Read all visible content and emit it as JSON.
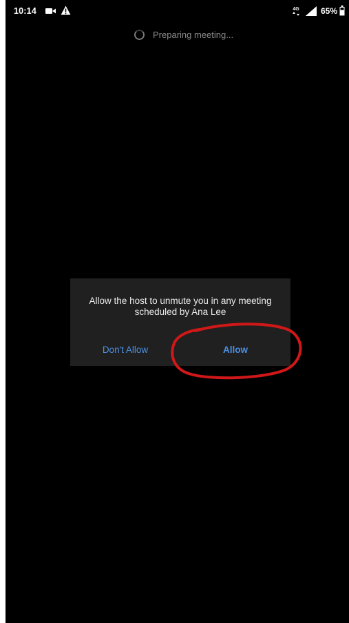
{
  "status_bar": {
    "time": "10:14",
    "battery": "65%",
    "icons": [
      "video-icon",
      "alert-icon",
      "4g-icon",
      "signal-icon",
      "battery-icon"
    ]
  },
  "meeting": {
    "status": "Preparing meeting..."
  },
  "dialog": {
    "message_line1": "Allow the host to unmute you in any meeting",
    "message_line2": "scheduled by Ana Lee",
    "deny_label": "Don't Allow",
    "allow_label": "Allow"
  },
  "colors": {
    "background": "#000000",
    "dialog": "#202020",
    "button_text": "#4a8fe0",
    "annotation": "#d01818"
  }
}
